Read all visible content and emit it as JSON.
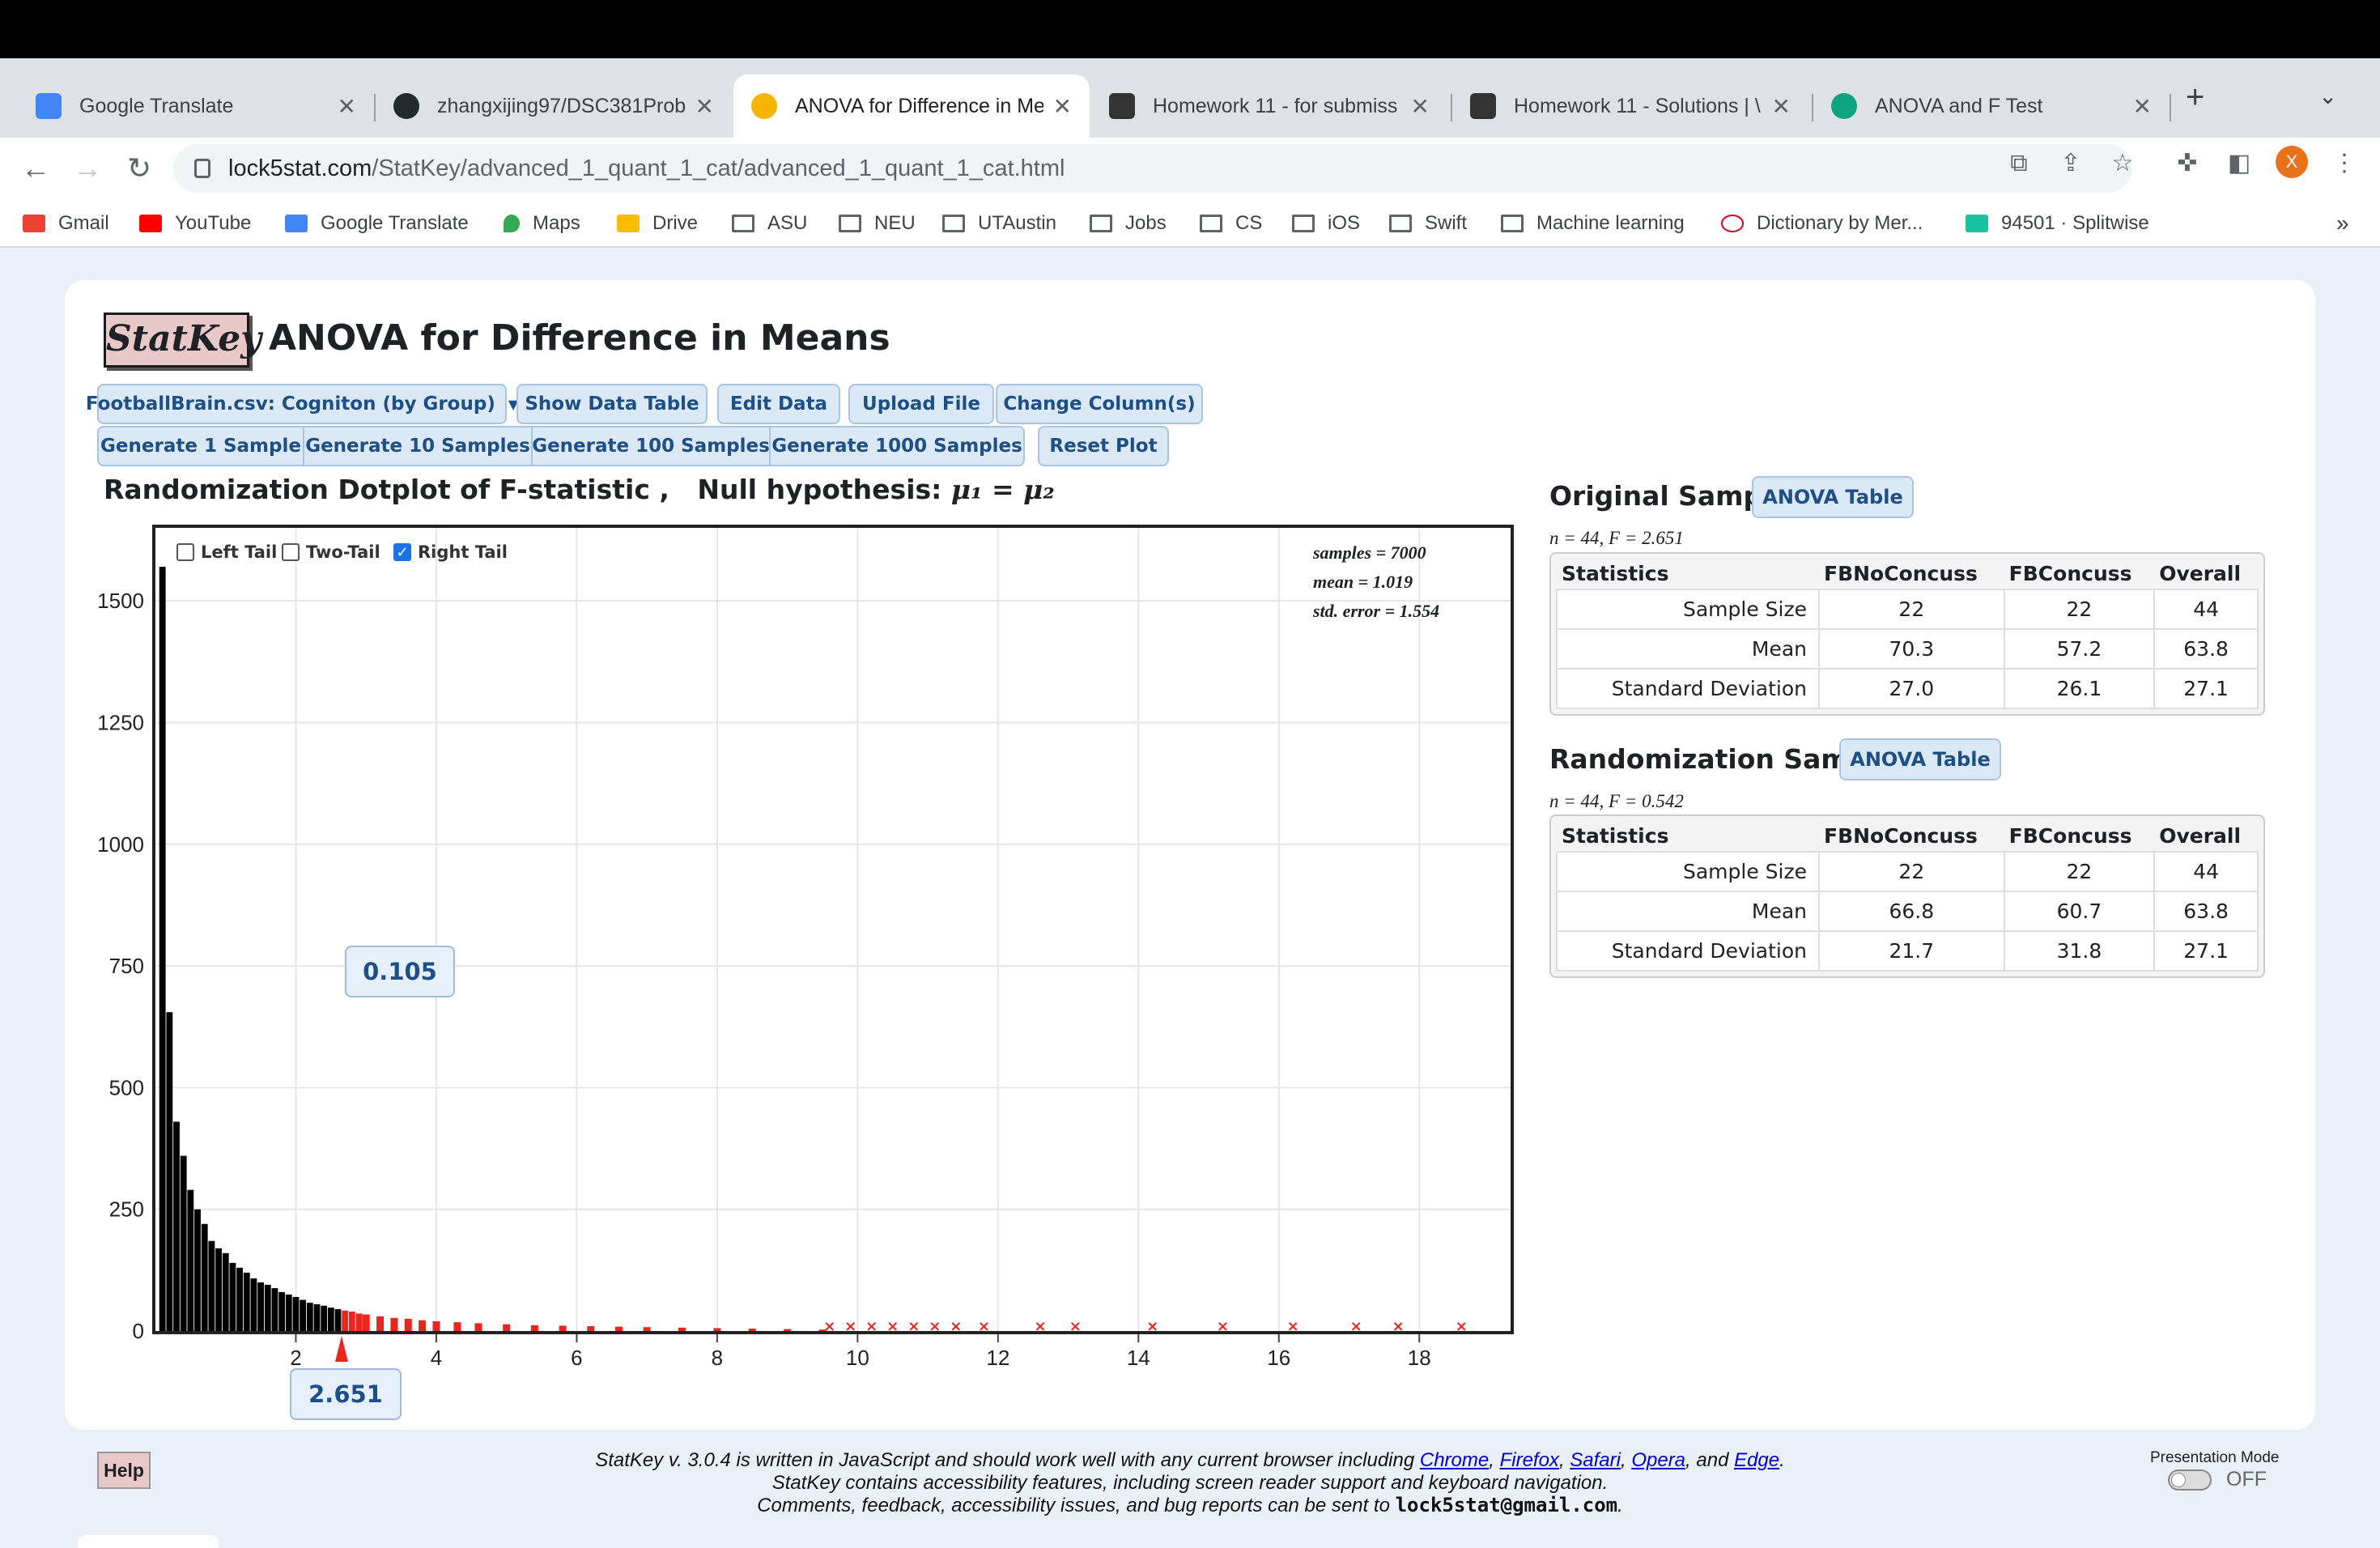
{
  "browser": {
    "tabs": [
      {
        "title": "Google Translate",
        "icon": "google-translate-icon",
        "color": "#4285f4",
        "active": false
      },
      {
        "title": "zhangxijing97/DSC381Prob",
        "icon": "github-icon",
        "color": "#24292f",
        "active": false
      },
      {
        "title": "ANOVA for Difference in Me",
        "icon": "lock-icon",
        "color": "#f4b400",
        "active": true
      },
      {
        "title": "Homework 11 - for submiss",
        "icon": "edx-icon",
        "color": "#333333",
        "active": false
      },
      {
        "title": "Homework 11 - Solutions | \\",
        "icon": "edx-icon",
        "color": "#333333",
        "active": false
      },
      {
        "title": "ANOVA and F Test",
        "icon": "chatgpt-icon",
        "color": "#10a37f",
        "active": false
      }
    ],
    "url_host": "lock5stat.com",
    "url_path": "/StatKey/advanced_1_quant_1_cat/advanced_1_quant_1_cat.html",
    "avatar_letter": "X",
    "bookmarks": [
      {
        "label": "Gmail",
        "icon": "gmail-icon",
        "color": "#ea4335"
      },
      {
        "label": "YouTube",
        "icon": "youtube-icon",
        "color": "#ff0000"
      },
      {
        "label": "Google Translate",
        "icon": "google-translate-icon",
        "color": "#4285f4"
      },
      {
        "label": "Maps",
        "icon": "maps-icon",
        "color": "#34a853"
      },
      {
        "label": "Drive",
        "icon": "drive-icon",
        "color": "#fbbc04"
      },
      {
        "label": "ASU",
        "icon": "folder-icon",
        "color": ""
      },
      {
        "label": "NEU",
        "icon": "folder-icon",
        "color": ""
      },
      {
        "label": "UTAustin",
        "icon": "folder-icon",
        "color": ""
      },
      {
        "label": "Jobs",
        "icon": "folder-icon",
        "color": ""
      },
      {
        "label": "CS",
        "icon": "folder-icon",
        "color": ""
      },
      {
        "label": "iOS",
        "icon": "folder-icon",
        "color": ""
      },
      {
        "label": "Swift",
        "icon": "folder-icon",
        "color": ""
      },
      {
        "label": "Machine learning",
        "icon": "folder-icon",
        "color": ""
      },
      {
        "label": "Dictionary by Mer...",
        "icon": "merriam-webster-icon",
        "color": "#d0021b"
      },
      {
        "label": "94501 · Splitwise",
        "icon": "splitwise-icon",
        "color": "#1cc29f"
      }
    ],
    "more_bookmarks": "»"
  },
  "app": {
    "logo": "StatKey",
    "title": "ANOVA for Difference in Means",
    "dataset_select": "FootballBrain.csv: Cogniton (by Group)",
    "buttons_row1": [
      "Show Data Table",
      "Edit Data",
      "Upload File",
      "Change Column(s)"
    ],
    "buttons_row2": [
      "Generate 1 Sample",
      "Generate 10 Samples",
      "Generate 100 Samples",
      "Generate 1000 Samples",
      "Reset Plot"
    ],
    "plot_heading": "Randomization Dotplot of F-statistic ,   Null hypothesis: ",
    "null_hypothesis": "μ₁ = μ₂",
    "tails": [
      {
        "label": "Left Tail",
        "checked": false
      },
      {
        "label": "Two-Tail",
        "checked": false
      },
      {
        "label": "Right Tail",
        "checked": true
      }
    ],
    "summary": [
      "samples = 7000",
      "mean = 1.019",
      "std. error = 1.554"
    ],
    "tail_proportion": "0.105",
    "observed_stat": "2.651",
    "original": {
      "title": "Original Sample",
      "anova_button": "ANOVA Table",
      "n_line": "n = 44, F = 2.651",
      "headers": [
        "Statistics",
        "FBNoConcuss",
        "FBConcuss",
        "Overall"
      ],
      "rows": [
        [
          "Sample Size",
          "22",
          "22",
          "44"
        ],
        [
          "Mean",
          "70.3",
          "57.2",
          "63.8"
        ],
        [
          "Standard Deviation",
          "27.0",
          "26.1",
          "27.1"
        ]
      ]
    },
    "randomization": {
      "title": "Randomization Sample",
      "anova_button": "ANOVA Table",
      "n_line": "n = 44, F = 0.542",
      "headers": [
        "Statistics",
        "FBNoConcuss",
        "FBConcuss",
        "Overall"
      ],
      "rows": [
        [
          "Sample Size",
          "22",
          "22",
          "44"
        ],
        [
          "Mean",
          "66.8",
          "60.7",
          "63.8"
        ],
        [
          "Standard Deviation",
          "21.7",
          "31.8",
          "27.1"
        ]
      ]
    },
    "help": "Help",
    "footer_line1_pre": "StatKey v. 3.0.4 is written in JavaScript and should work well with any current browser including ",
    "footer_browsers": [
      "Chrome",
      "Firefox",
      "Safari",
      "Opera",
      "Edge"
    ],
    "footer_line2": "StatKey contains accessibility features, including screen reader support and keyboard navigation.",
    "footer_line3_pre": "Comments, feedback, accessibility issues, and bug reports can be sent to ",
    "footer_email": "lock5stat@gmail.com",
    "presentation_mode_label": "Presentation Mode",
    "presentation_mode_state": "OFF"
  },
  "chart_data": {
    "type": "dotplot-histogram",
    "xlabel": "",
    "ylabel": "",
    "x_ticks": [
      2,
      4,
      6,
      8,
      10,
      12,
      14,
      16,
      18
    ],
    "y_ticks": [
      0,
      250,
      500,
      750,
      1000,
      1250,
      1500
    ],
    "xlim": [
      0,
      19.3
    ],
    "ylim": [
      0,
      1650
    ],
    "threshold": 2.651,
    "tail": "right",
    "colors": {
      "below": "#000000",
      "tail": "#e8281f",
      "marker": "#e8281f"
    },
    "bins": [
      {
        "x": 0.1,
        "count": 1570
      },
      {
        "x": 0.2,
        "count": 655
      },
      {
        "x": 0.3,
        "count": 430
      },
      {
        "x": 0.4,
        "count": 360
      },
      {
        "x": 0.5,
        "count": 290
      },
      {
        "x": 0.6,
        "count": 250
      },
      {
        "x": 0.7,
        "count": 220
      },
      {
        "x": 0.8,
        "count": 185
      },
      {
        "x": 0.9,
        "count": 170
      },
      {
        "x": 1.0,
        "count": 160
      },
      {
        "x": 1.1,
        "count": 140
      },
      {
        "x": 1.2,
        "count": 130
      },
      {
        "x": 1.3,
        "count": 120
      },
      {
        "x": 1.4,
        "count": 108
      },
      {
        "x": 1.5,
        "count": 100
      },
      {
        "x": 1.6,
        "count": 95
      },
      {
        "x": 1.7,
        "count": 88
      },
      {
        "x": 1.8,
        "count": 80
      },
      {
        "x": 1.9,
        "count": 75
      },
      {
        "x": 2.0,
        "count": 70
      },
      {
        "x": 2.1,
        "count": 64
      },
      {
        "x": 2.2,
        "count": 58
      },
      {
        "x": 2.3,
        "count": 55
      },
      {
        "x": 2.4,
        "count": 52
      },
      {
        "x": 2.5,
        "count": 48
      },
      {
        "x": 2.6,
        "count": 45
      },
      {
        "x": 2.7,
        "count": 42
      },
      {
        "x": 2.8,
        "count": 40
      },
      {
        "x": 2.9,
        "count": 36
      },
      {
        "x": 3.0,
        "count": 34
      },
      {
        "x": 3.2,
        "count": 30
      },
      {
        "x": 3.4,
        "count": 27
      },
      {
        "x": 3.6,
        "count": 25
      },
      {
        "x": 3.8,
        "count": 22
      },
      {
        "x": 4.0,
        "count": 20
      },
      {
        "x": 4.3,
        "count": 18
      },
      {
        "x": 4.6,
        "count": 16
      },
      {
        "x": 5.0,
        "count": 14
      },
      {
        "x": 5.4,
        "count": 12
      },
      {
        "x": 5.8,
        "count": 11
      },
      {
        "x": 6.2,
        "count": 10
      },
      {
        "x": 6.6,
        "count": 9
      },
      {
        "x": 7.0,
        "count": 8
      },
      {
        "x": 7.5,
        "count": 7
      },
      {
        "x": 8.0,
        "count": 6
      },
      {
        "x": 8.5,
        "count": 5
      },
      {
        "x": 9.0,
        "count": 4
      },
      {
        "x": 9.5,
        "count": 3
      }
    ],
    "outliers": [
      9.6,
      9.9,
      10.2,
      10.5,
      10.8,
      11.1,
      11.4,
      11.8,
      12.6,
      13.1,
      14.2,
      15.2,
      16.2,
      17.1,
      17.7,
      18.6
    ]
  }
}
